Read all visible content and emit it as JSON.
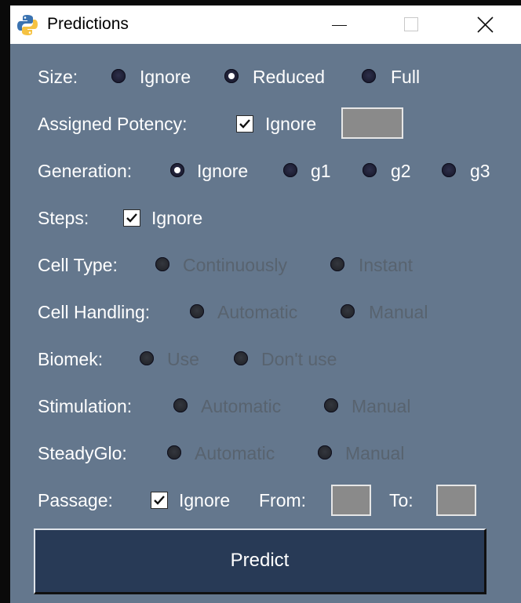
{
  "window": {
    "title": "Predictions",
    "icon": "python-icon",
    "controls": {
      "minimize": "minimize-icon",
      "maximize": "maximize-icon",
      "close": "close-icon"
    }
  },
  "form": {
    "size": {
      "label": "Size:",
      "options": [
        "Ignore",
        "Reduced",
        "Full"
      ],
      "selected": "Reduced"
    },
    "assigned_potency": {
      "label": "Assigned Potency:",
      "checkbox_label": "Ignore",
      "checked": true,
      "value": ""
    },
    "generation": {
      "label": "Generation:",
      "options": [
        "Ignore",
        "g1",
        "g2",
        "g3"
      ],
      "selected": "Ignore"
    },
    "steps": {
      "label": "Steps:",
      "checkbox_label": "Ignore",
      "checked": true
    },
    "cell_type": {
      "label": "Cell Type:",
      "options": [
        "Continuously",
        "Instant"
      ],
      "disabled": true
    },
    "cell_handling": {
      "label": "Cell Handling:",
      "options": [
        "Automatic",
        "Manual"
      ],
      "disabled": true
    },
    "biomek": {
      "label": "Biomek:",
      "options": [
        "Use",
        "Don't use"
      ],
      "disabled": true
    },
    "stimulation": {
      "label": "Stimulation:",
      "options": [
        "Automatic",
        "Manual"
      ],
      "disabled": true
    },
    "steadyglo": {
      "label": "SteadyGlo:",
      "options": [
        "Automatic",
        "Manual"
      ],
      "disabled": true
    },
    "passage": {
      "label": "Passage:",
      "checkbox_label": "Ignore",
      "checked": true,
      "from_label": "From:",
      "to_label": "To:",
      "from_value": "",
      "to_value": ""
    }
  },
  "predict_button": "Predict",
  "colors": {
    "background": "#64778d",
    "button": "#283a56",
    "text": "#ffffff",
    "disabled_text": "#58636f",
    "entry": "#8a8a8a"
  }
}
